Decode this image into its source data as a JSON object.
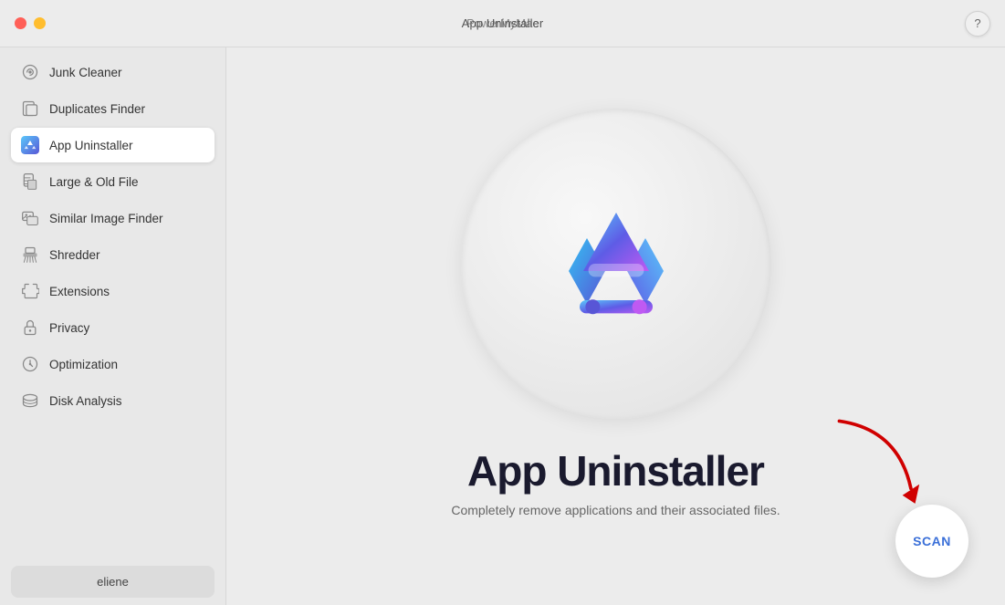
{
  "titlebar": {
    "app_name": "PowerMyMac",
    "section_title": "App Uninstaller",
    "help_label": "?"
  },
  "sidebar": {
    "items": [
      {
        "id": "junk-cleaner",
        "label": "Junk Cleaner",
        "icon": "junk-icon",
        "active": false
      },
      {
        "id": "duplicates-finder",
        "label": "Duplicates Finder",
        "icon": "duplicate-icon",
        "active": false
      },
      {
        "id": "app-uninstaller",
        "label": "App Uninstaller",
        "icon": "app-icon",
        "active": true
      },
      {
        "id": "large-old-file",
        "label": "Large & Old File",
        "icon": "file-icon",
        "active": false
      },
      {
        "id": "similar-image-finder",
        "label": "Similar Image Finder",
        "icon": "image-icon",
        "active": false
      },
      {
        "id": "shredder",
        "label": "Shredder",
        "icon": "shredder-icon",
        "active": false
      },
      {
        "id": "extensions",
        "label": "Extensions",
        "icon": "extensions-icon",
        "active": false
      },
      {
        "id": "privacy",
        "label": "Privacy",
        "icon": "privacy-icon",
        "active": false
      },
      {
        "id": "optimization",
        "label": "Optimization",
        "icon": "optimization-icon",
        "active": false
      },
      {
        "id": "disk-analysis",
        "label": "Disk Analysis",
        "icon": "disk-icon",
        "active": false
      }
    ],
    "user": {
      "name": "eliene"
    }
  },
  "main": {
    "feature_title": "App Uninstaller",
    "feature_desc": "Completely remove applications and their associated files.",
    "scan_label": "SCAN"
  }
}
